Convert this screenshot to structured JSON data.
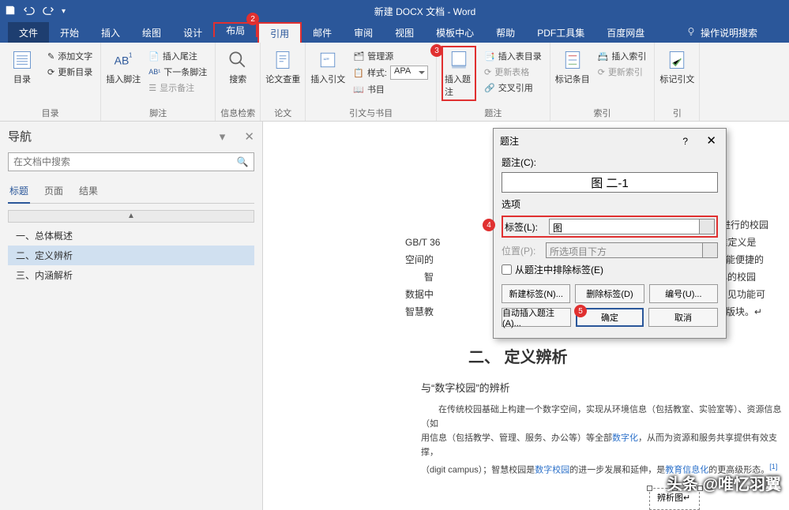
{
  "titlebar": {
    "title": "新建 DOCX 文档  -  Word"
  },
  "tabs": {
    "file": "文件",
    "home": "开始",
    "insert": "插入",
    "draw": "绘图",
    "design": "设计",
    "layout": "布局",
    "references": "引用",
    "mailings": "邮件",
    "review": "审阅",
    "view": "视图",
    "template": "模板中心",
    "help": "帮助",
    "pdf": "PDF工具集",
    "baidu": "百度网盘",
    "tellme": "操作说明搜索"
  },
  "annotations": {
    "n2": "2",
    "n3": "3",
    "n4": "4",
    "n5": "5"
  },
  "ribbon": {
    "toc": {
      "label": "目录",
      "btn": "目录",
      "add_text": "添加文字",
      "update": "更新目录"
    },
    "footnotes": {
      "label": "脚注",
      "insert_fn": "插入脚注",
      "insert_en": "插入尾注",
      "next_fn": "下一条脚注",
      "show_notes": "显示备注"
    },
    "research": {
      "label": "信息检索",
      "search": "搜索"
    },
    "smart": {
      "label": "论文",
      "check": "论文查重"
    },
    "citations": {
      "label": "引文与书目",
      "insert_cite": "插入引文",
      "manage": "管理源",
      "style": "样式:",
      "style_val": "APA",
      "bib": "书目"
    },
    "captions": {
      "label": "题注",
      "insert_caption": "插入题注",
      "insert_tof": "插入表目录",
      "update_tof": "更新表格",
      "crossref": "交叉引用"
    },
    "index": {
      "label": "索引",
      "mark": "标记条目",
      "insert_index": "插入索引",
      "update_index": "更新索引"
    },
    "toa": {
      "label": "引",
      "mark_cite": "标记引文"
    }
  },
  "nav": {
    "title": "导航",
    "search_ph": "在文档中搜索",
    "tabs": {
      "headings": "标题",
      "pages": "页面",
      "results": "结果"
    },
    "collapse": "▲",
    "items": [
      "一、总体概述",
      "二、定义辨析",
      "三、内涵解析"
    ]
  },
  "document": {
    "frag_line1_a": "进行的校园",
    "frag_line2_a": "GB/T 36",
    "frag_line2_b": "标准定义是",
    "frag_line3_a": "空间的",
    "frag_line3_b": "都能便捷的",
    "frag_line4_a": "智",
    "frag_line4_b": "心的校园",
    "frag_line5_a": "数据中",
    "frag_line5_b": "常见功能可",
    "frag_line6_a": "智慧教",
    "frag_line6_b": "版块。↵",
    "heading2": "二、 定义辨析",
    "sub1": "与“数字校园”的辨析",
    "body1": "在传统校园基础上构建一个数字空间，实现从环境信息（包括教室、实验室等）、资源信息（如",
    "body2_a": "用信息（包括教学、管理、服务、办公等）等全部",
    "body2_link": "数字化",
    "body2_b": "，从而为资源和服务共享提供有效支撑，",
    "body3_a": "（digit campus）；智慧校园是",
    "body3_link": "数字校园",
    "body3_b": "的进一步发展和延伸，是",
    "body3_link2": "教育信息化",
    "body3_c": "的更高级形态。",
    "body3_ref": "[1]",
    "sel_caption": "辨析图↵"
  },
  "dialog": {
    "title": "题注",
    "caption_label": "题注(C):",
    "caption_value": "图 二-1",
    "options": "选项",
    "label_l": "标签(L):",
    "label_val": "图",
    "pos_l": "位置(P):",
    "pos_val": "所选项目下方",
    "exclude": "从题注中排除标签(E)",
    "new_label": "新建标签(N)...",
    "del_label": "删除标签(D)",
    "numbering": "编号(U)...",
    "auto": "自动插入题注(A)...",
    "ok": "确定",
    "cancel": "取消"
  },
  "watermark": "头条 @唯忆羽翼"
}
